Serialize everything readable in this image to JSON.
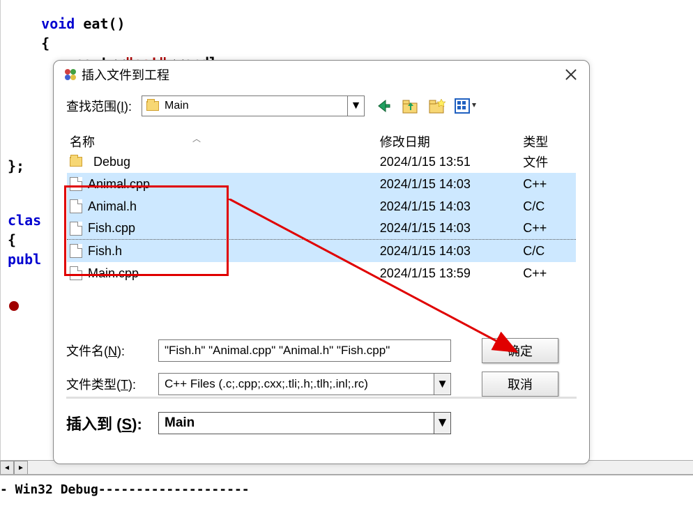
{
  "code": {
    "line1_pre": "    ",
    "line1_kw": "void",
    "line1_post": " eat()",
    "line2": "    {",
    "line3_pre": "        cout<<",
    "line3_str": "\"eat\"",
    "line3_post": "<<endl;",
    "line4": "};",
    "line5_kw": "clas",
    "line6": "{",
    "line7_kw": "publ"
  },
  "output": {
    "text": "  - Win32 Debug--------------------"
  },
  "dialog": {
    "title": "插入文件到工程",
    "location_label": "查找范围(",
    "location_label_u": "I",
    "location_label_end": "):",
    "location_value": "Main",
    "columns": {
      "name": "名称",
      "date": "修改日期",
      "type": "类型"
    },
    "files": [
      {
        "name": "Debug",
        "date": "2024/1/15 13:51",
        "type": "文件",
        "is_folder": true,
        "selected": false
      },
      {
        "name": "Animal.cpp",
        "date": "2024/1/15 14:03",
        "type": "C++",
        "is_folder": false,
        "selected": true
      },
      {
        "name": "Animal.h",
        "date": "2024/1/15 14:03",
        "type": "C/C",
        "is_folder": false,
        "selected": true
      },
      {
        "name": "Fish.cpp",
        "date": "2024/1/15 14:03",
        "type": "C++",
        "is_folder": false,
        "selected": true
      },
      {
        "name": "Fish.h",
        "date": "2024/1/15 14:03",
        "type": "C/C",
        "is_folder": false,
        "selected": true
      },
      {
        "name": "Main.cpp",
        "date": "2024/1/15 13:59",
        "type": "C++",
        "is_folder": false,
        "selected": false
      }
    ],
    "filename_label": "文件名(",
    "filename_label_u": "N",
    "filename_label_end": "):",
    "filename_value": "\"Fish.h\" \"Animal.cpp\" \"Animal.h\" \"Fish.cpp\"",
    "filetype_label": "文件类型(",
    "filetype_label_u": "T",
    "filetype_label_end": "):",
    "filetype_value": "C++ Files (.c;.cpp;.cxx;.tli;.h;.tlh;.inl;.rc)",
    "insert_label": "插入到 (",
    "insert_label_u": "S",
    "insert_label_end": "):",
    "insert_value": "Main",
    "ok_button": "确定",
    "cancel_button": "取消"
  }
}
